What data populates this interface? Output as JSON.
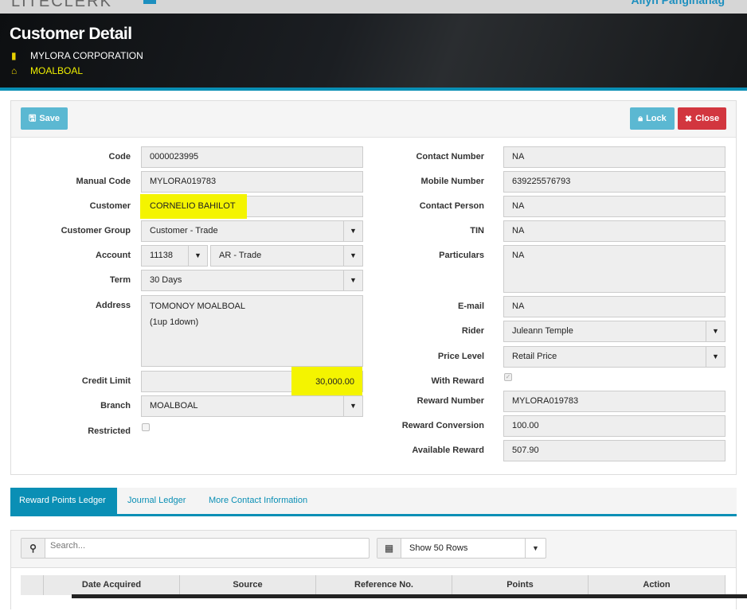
{
  "topbar": {
    "logo": "LITECLERK",
    "user": "Ailyn Panginanag"
  },
  "header": {
    "title": "Customer Detail",
    "company": "MYLORA CORPORATION",
    "branch": "MOALBOAL"
  },
  "toolbar": {
    "save": "Save",
    "lock": "Lock",
    "close": "Close"
  },
  "left": [
    {
      "label": "Code",
      "value": "0000023995"
    },
    {
      "label": "Manual Code",
      "value": "MYLORA019783"
    },
    {
      "label": "Customer",
      "value": "CORNELIO BAHILOT"
    },
    {
      "label": "Customer Group",
      "value": "Customer - Trade"
    },
    {
      "label": "Account",
      "value": "11138",
      "value2": "AR - Trade"
    },
    {
      "label": "Term",
      "value": "30 Days"
    },
    {
      "label": "Address",
      "value": "TOMONOY MOALBOAL",
      "value2": "(1up 1down)"
    },
    {
      "label": "Credit Limit",
      "value": "30,000.00"
    },
    {
      "label": "Branch",
      "value": "MOALBOAL"
    },
    {
      "label": "Restricted"
    }
  ],
  "right": [
    {
      "label": "Contact Number",
      "value": "NA"
    },
    {
      "label": "Mobile Number",
      "value": "639225576793"
    },
    {
      "label": "Contact Person",
      "value": "NA"
    },
    {
      "label": "TIN",
      "value": "NA"
    },
    {
      "label": "Particulars",
      "value": "NA"
    },
    {
      "label": "E-mail",
      "value": "NA"
    },
    {
      "label": "Rider",
      "value": "Juleann Temple"
    },
    {
      "label": "Price Level",
      "value": "Retail Price"
    },
    {
      "label": "With Reward"
    },
    {
      "label": "Reward Number",
      "value": "MYLORA019783"
    },
    {
      "label": "Reward Conversion",
      "value": "100.00"
    },
    {
      "label": "Available Reward",
      "value": "507.90"
    }
  ],
  "tabs": [
    "Reward Points Ledger",
    "Journal Ledger",
    "More Contact Information"
  ],
  "ledger": {
    "search_placeholder": "Search...",
    "rows": "Show 50 Rows",
    "columns": [
      "Date Acquired",
      "Source",
      "Reference No.",
      "Points",
      "Action"
    ]
  }
}
